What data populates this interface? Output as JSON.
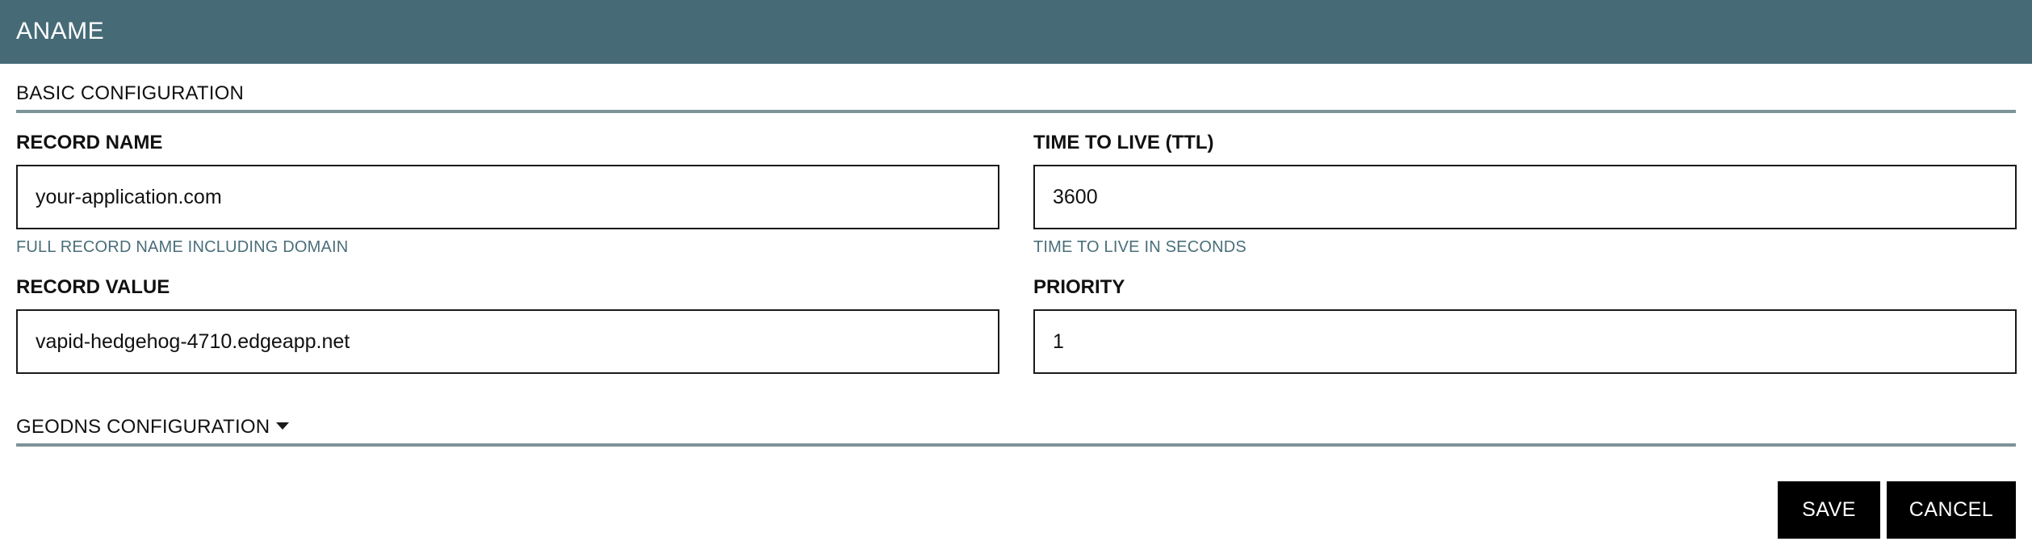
{
  "header": {
    "title": "ANAME"
  },
  "basic_section": {
    "title": "BASIC CONFIGURATION"
  },
  "fields": {
    "record_name": {
      "label": "RECORD NAME",
      "value": "your-application.com",
      "help": "FULL RECORD NAME INCLUDING DOMAIN"
    },
    "ttl": {
      "label": "TIME TO LIVE (TTL)",
      "value": "3600",
      "help": "TIME TO LIVE IN SECONDS"
    },
    "record_value": {
      "label": "RECORD VALUE",
      "value": "vapid-hedgehog-4710.edgeapp.net"
    },
    "priority": {
      "label": "PRIORITY",
      "value": "1"
    }
  },
  "geodns_section": {
    "title": "GEODNS CONFIGURATION",
    "icon": "caret-down-icon"
  },
  "actions": {
    "save_label": "SAVE",
    "cancel_label": "CANCEL"
  },
  "colors": {
    "header_bg": "#466b77",
    "rule": "#7d939a",
    "help_text": "#4a6e7a",
    "button_bg": "#000000"
  }
}
